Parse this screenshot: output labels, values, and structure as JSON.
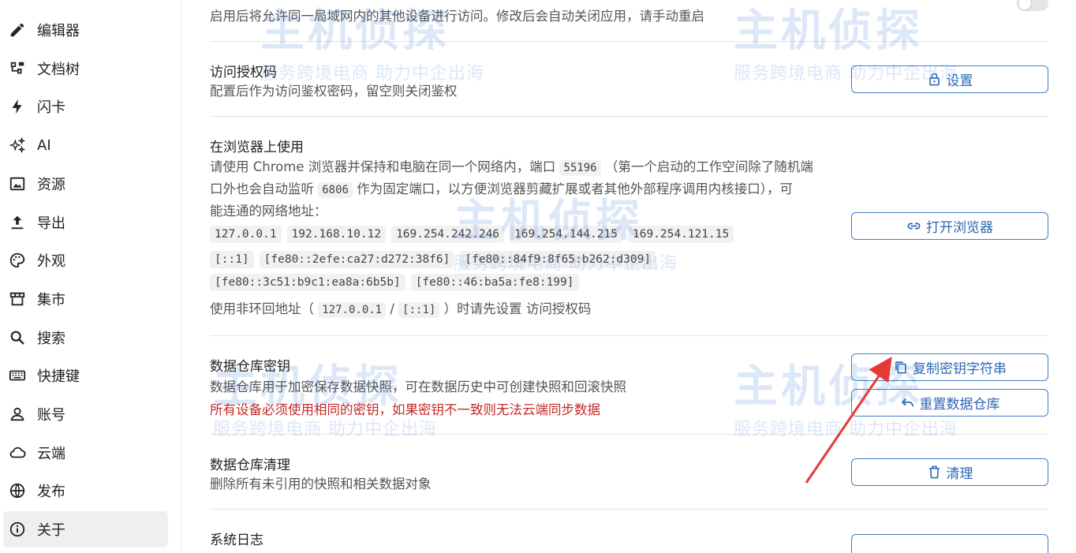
{
  "sidebar": {
    "items": [
      {
        "label": "编辑器",
        "icon": "pencil-icon"
      },
      {
        "label": "文档树",
        "icon": "tree-icon"
      },
      {
        "label": "闪卡",
        "icon": "lightning-icon"
      },
      {
        "label": "AI",
        "icon": "sparkle-icon"
      },
      {
        "label": "资源",
        "icon": "image-icon"
      },
      {
        "label": "导出",
        "icon": "upload-icon"
      },
      {
        "label": "外观",
        "icon": "palette-icon"
      },
      {
        "label": "集市",
        "icon": "store-icon"
      },
      {
        "label": "搜索",
        "icon": "search-icon"
      },
      {
        "label": "快捷键",
        "icon": "keyboard-icon"
      },
      {
        "label": "账号",
        "icon": "user-icon"
      },
      {
        "label": "云端",
        "icon": "cloud-icon"
      },
      {
        "label": "发布",
        "icon": "globe-icon"
      },
      {
        "label": "关于",
        "icon": "info-icon"
      }
    ],
    "active": "关于"
  },
  "lan": {
    "desc": "启用后将允许同一局域网内的其他设备进行访问。修改后会自动关闭应用，请手动重启"
  },
  "auth": {
    "title": "访问授权码",
    "desc": "配置后作为访问鉴权密码，留空则关闭鉴权",
    "button": "设置"
  },
  "browser": {
    "title": "在浏览器上使用",
    "desc_1a": "请使用 Chrome 浏览器并保持和电脑在同一个网络内，端口",
    "port": "55196",
    "desc_1b": "（第一个启动的工作空间除了随机端",
    "desc_2a": "口外也会自动监听",
    "fixed_port": "6806",
    "desc_2b": "作为固定端口，以方便浏览器剪藏扩展或者其他外部程序调用内核接口），可",
    "desc_3": "能连通的网络地址：",
    "addresses_line1": [
      "127.0.0.1",
      "192.168.10.12",
      "169.254.242.246",
      "169.254.144.215",
      "169.254.121.15"
    ],
    "addresses_line2": [
      "[::1]",
      "[fe80::2efe:ca27:d272:38f6]",
      "[fe80::84f9:8f65:b262:d309]"
    ],
    "addresses_line3": [
      "[fe80::3c51:b9c1:ea8a:6b5b]",
      "[fe80::46:ba5a:fe8:199]"
    ],
    "note_a": "使用非环回地址（",
    "note_code1": "127.0.0.1",
    "note_sep": "/",
    "note_code2": "[::1]",
    "note_b": "）时请先设置 访问授权码",
    "button": "打开浏览器"
  },
  "repo_key": {
    "title": "数据仓库密钥",
    "desc": "数据仓库用于加密保存数据快照，可在数据历史中可创建快照和回滚快照",
    "warning": "所有设备必须使用相同的密钥，如果密钥不一致则无法云端同步数据",
    "button_copy": "复制密钥字符串",
    "button_reset": "重置数据仓库"
  },
  "repo_purge": {
    "title": "数据仓库清理",
    "desc": "删除所有未引用的快照和相关数据对象",
    "button": "清理"
  },
  "syslog": {
    "title": "系统日志"
  },
  "watermark": {
    "brand": "主机侦探",
    "slogan": "服务跨境电商 助力中企出海"
  },
  "colors": {
    "accent": "#2c67b3",
    "warning": "#c62828",
    "arrow": "#e53935"
  }
}
